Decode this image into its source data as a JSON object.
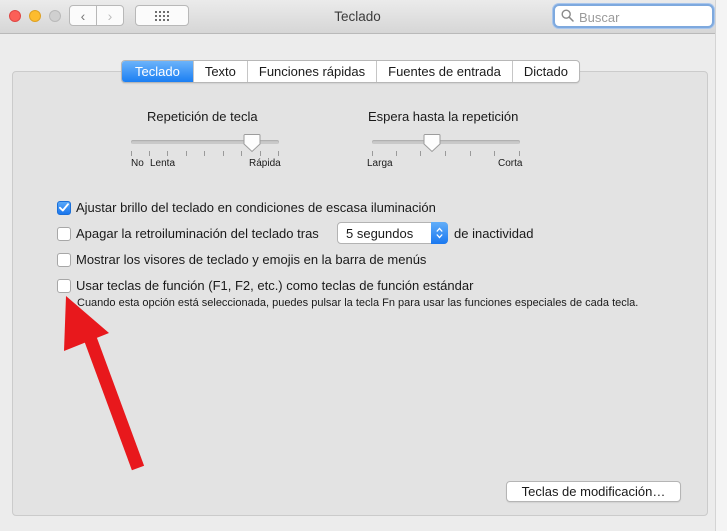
{
  "window": {
    "title": "Teclado",
    "search_placeholder": "Buscar",
    "back_glyph": "‹",
    "forward_glyph": "›",
    "grid_glyph": "⋮⋮⋮⋮"
  },
  "tabs": [
    {
      "label": "Teclado",
      "active": true
    },
    {
      "label": "Texto",
      "active": false
    },
    {
      "label": "Funciones rápidas",
      "active": false
    },
    {
      "label": "Fuentes de entrada",
      "active": false
    },
    {
      "label": "Dictado",
      "active": false
    }
  ],
  "key_repeat": {
    "label": "Repetición de tecla",
    "min_label": "No",
    "low_label": "Lenta",
    "high_label": "Rápida"
  },
  "delay_until_repeat": {
    "label": "Espera hasta la repetición",
    "low_label": "Larga",
    "high_label": "Corta"
  },
  "options": {
    "adjust_brightness": {
      "label": "Ajustar brillo del teclado en condiciones de escasa iluminación",
      "checked": true
    },
    "backlight_off": {
      "label": "Apagar la retroiluminación del teclado tras",
      "checked": false,
      "suffix": "de inactividad"
    },
    "show_viewers": {
      "label": "Mostrar los visores de teclado y emojis en la barra de menús",
      "checked": false
    },
    "fn_keys": {
      "label": "Usar teclas de función (F1, F2, etc.) como teclas de función estándar",
      "checked": false
    }
  },
  "backlight_timeout": "5 segundos",
  "fn_hint": "Cuando esta opción está seleccionada, puedes pulsar la tecla Fn para usar las funciones especiales de cada tecla.",
  "modifier_button": "Teclas de modificación…",
  "annotation": {
    "color": "#e8181c"
  }
}
